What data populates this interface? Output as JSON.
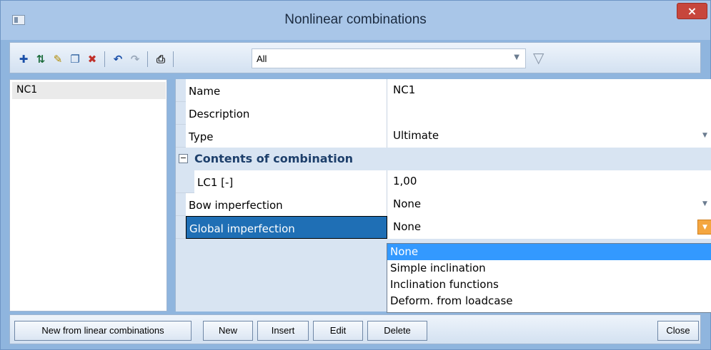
{
  "window": {
    "title": "Nonlinear combinations",
    "close_label": "×"
  },
  "toolbar": {
    "icons": [
      "new-icon",
      "split-icon",
      "edit-pencil-icon",
      "copy-icon",
      "delete-icon",
      "undo-icon",
      "redo-icon",
      "print-icon"
    ],
    "filter_value": "All",
    "filter_icon": "funnel-icon"
  },
  "list": {
    "items": [
      "NC1"
    ]
  },
  "properties": {
    "name_label": "Name",
    "name_value": "NC1",
    "description_label": "Description",
    "description_value": "",
    "type_label": "Type",
    "type_value": "Ultimate",
    "section_label": "Contents of combination",
    "lc1_label": "LC1 [-]",
    "lc1_value": "1,00",
    "bow_label": "Bow imperfection",
    "bow_value": "None",
    "global_label": "Global imperfection",
    "global_value": "None"
  },
  "dropdown": {
    "options": [
      "None",
      "Simple inclination",
      "Inclination functions",
      "Deform. from loadcase"
    ],
    "selected": "None"
  },
  "buttons": {
    "new_from_linear": "New from linear combinations",
    "new": "New",
    "insert": "Insert",
    "edit": "Edit",
    "delete": "Delete",
    "close": "Close"
  },
  "colors": {
    "selection": "#1f6fb5",
    "dropdown_highlight": "#3399ff",
    "active_arrow": "#f4a640"
  }
}
